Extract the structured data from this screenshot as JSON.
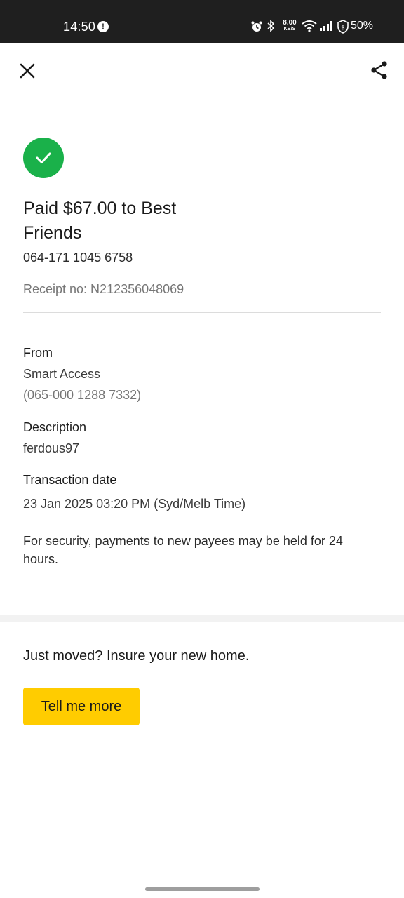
{
  "status_bar": {
    "time": "14:50",
    "notification_badge": "!",
    "net_speed_value": "8.00",
    "net_speed_unit": "KB/S",
    "battery": "50%"
  },
  "header": {
    "close_icon": "close-icon",
    "share_icon": "share-icon"
  },
  "payment": {
    "status_icon": "check-icon",
    "status_color": "#1ab14a",
    "title": "Paid $67.00 to Best Friends",
    "account_number": "064-171 1045 6758",
    "receipt": "Receipt no: N212356048069"
  },
  "details": {
    "from_label": "From",
    "from_name": "Smart Access",
    "from_account": "(065-000 1288 7332)",
    "description_label": "Description",
    "description_value": "ferdous97",
    "date_label": "Transaction date",
    "date_value": "23 Jan 2025 03:20 PM (Syd/Melb Time)",
    "security_note": "For security, payments to new payees may be held for 24 hours."
  },
  "promo": {
    "text": "Just moved? Insure your new home.",
    "button_label": "Tell me more",
    "button_color": "#ffcc00"
  }
}
